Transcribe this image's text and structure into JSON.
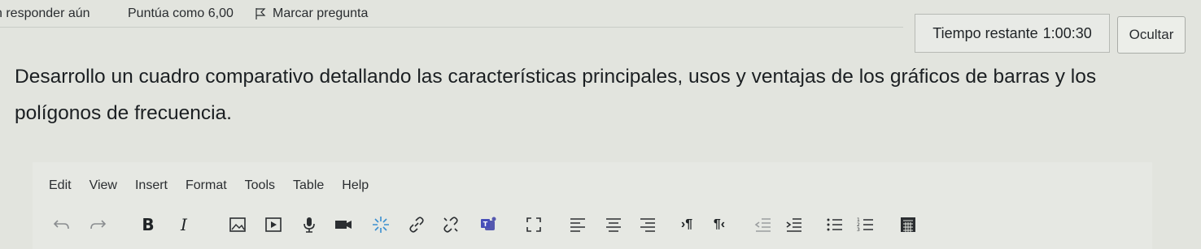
{
  "question": {
    "status": "n responder aún",
    "grade": "Puntúa como 6,00",
    "flag_label": "Marcar pregunta",
    "text": "Desarrollo un cuadro comparativo detallando las características principales, usos y ventajas de los gráficos de barras y los polígonos de frecuencia."
  },
  "timer": {
    "label": "Tiempo restante",
    "value": "1:00:30",
    "hide_label": "Ocultar"
  },
  "editor": {
    "menu": [
      "Edit",
      "View",
      "Insert",
      "Format",
      "Tools",
      "Table",
      "Help"
    ],
    "toolbar": {
      "bold": "B",
      "italic": "I",
      "ltr": "›¶",
      "rtl": "¶‹"
    },
    "icons": [
      "undo-icon",
      "redo-icon",
      "bold-icon",
      "italic-icon",
      "image-icon",
      "media-icon",
      "record-audio-icon",
      "record-video-icon",
      "h5p-icon",
      "link-icon",
      "unlink-icon",
      "teams-icon",
      "fullscreen-icon",
      "align-left-icon",
      "align-center-icon",
      "align-right-icon",
      "ltr-icon",
      "rtl-icon",
      "outdent-icon",
      "indent-icon",
      "bullet-list-icon",
      "numbered-list-icon",
      "equation-editor-icon"
    ]
  }
}
